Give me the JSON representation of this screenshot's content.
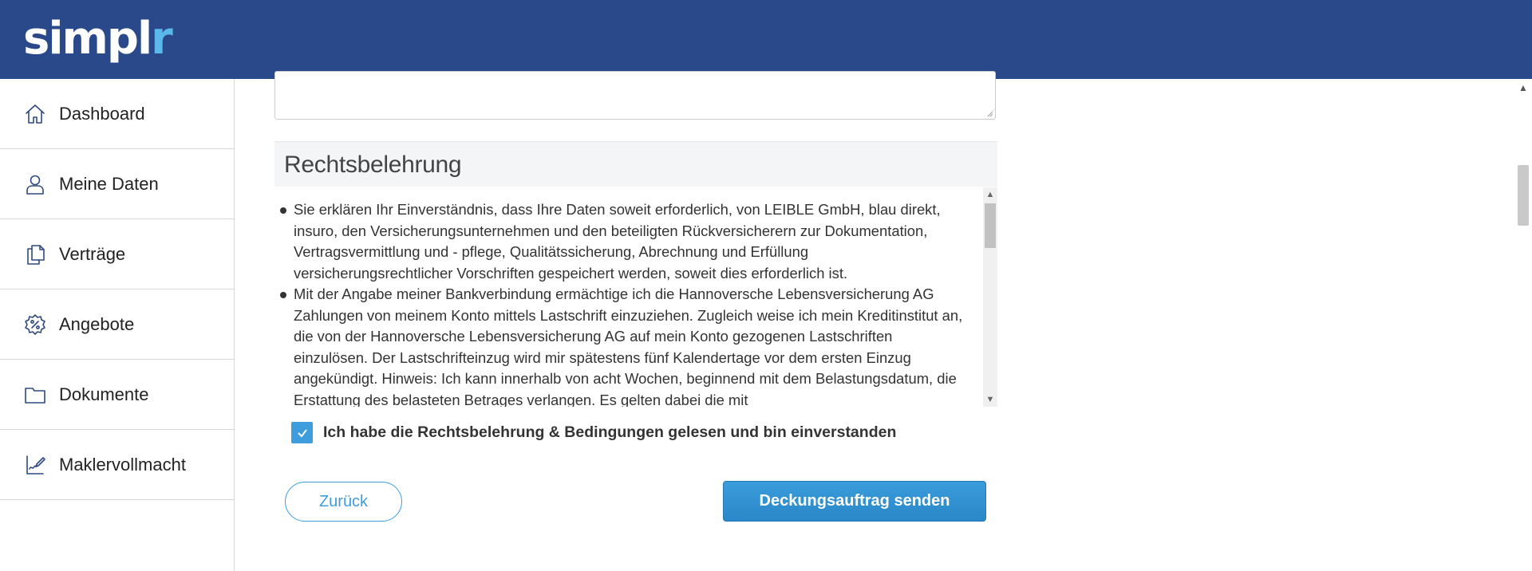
{
  "header": {
    "logo_main": "simpl",
    "logo_accent": "r",
    "colors": {
      "background": "#29498b",
      "accent": "#5bb8ea"
    }
  },
  "sidebar": {
    "items": [
      {
        "label": "Dashboard",
        "icon": "home-icon"
      },
      {
        "label": "Meine Daten",
        "icon": "user-icon"
      },
      {
        "label": "Verträge",
        "icon": "documents-icon"
      },
      {
        "label": "Angebote",
        "icon": "percent-badge-icon"
      },
      {
        "label": "Dokumente",
        "icon": "folder-icon"
      },
      {
        "label": "Maklervollmacht",
        "icon": "signature-icon"
      }
    ]
  },
  "main": {
    "textarea": {
      "value": ""
    },
    "rechtsbelehrung": {
      "title": "Rechtsbelehrung",
      "items": [
        "Sie erklären Ihr Einverständnis, dass Ihre Daten soweit erforderlich, von LEIBLE GmbH, blau direkt, insuro, den Versicherungsunternehmen und den beteiligten Rückversicherern zur Dokumentation, Vertragsvermittlung und - pflege, Qualitätssicherung, Abrechnung und Erfüllung versicherungsrechtlicher Vorschriften gespeichert werden, soweit dies erforderlich ist.",
        "Mit der Angabe meiner Bankverbindung ermächtige ich die Hannoversche Lebensversicherung AG Zahlungen von meinem Konto mittels Lastschrift einzuziehen. Zugleich weise ich mein Kreditinstitut an, die von der Hannoversche Lebensversicherung AG auf mein Konto gezogenen Lastschriften einzulösen. Der Lastschrifteinzug wird mir spätestens fünf Kalendertage vor dem ersten Einzug angekündigt. Hinweis: Ich kann innerhalb von acht Wochen, beginnend mit dem Belastungsdatum, die Erstattung des belasteten Betrages verlangen. Es gelten dabei die mit"
      ]
    },
    "agreement": {
      "checked": true,
      "label": "Ich habe die Rechtsbelehrung & Bedingungen gelesen und bin einverstanden"
    },
    "buttons": {
      "back_label": "Zurück",
      "send_label": "Deckungsauftrag senden"
    },
    "colors": {
      "primary": "#3d9ddd"
    }
  }
}
